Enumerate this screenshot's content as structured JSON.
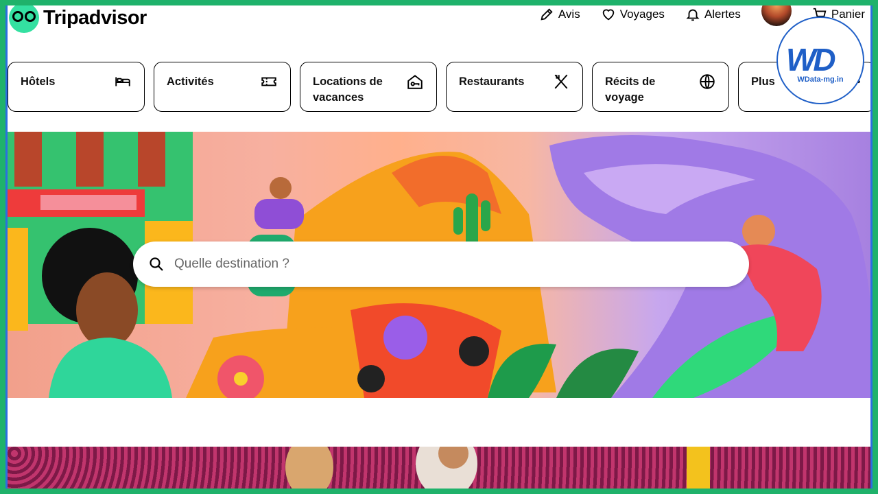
{
  "brand": {
    "name": "Tripadvisor"
  },
  "topnav": [
    {
      "id": "reviews",
      "label": "Avis",
      "icon": "pencil-icon"
    },
    {
      "id": "trips",
      "label": "Voyages",
      "icon": "heart-icon"
    },
    {
      "id": "alerts",
      "label": "Alertes",
      "icon": "bell-icon"
    },
    {
      "id": "cart",
      "label": "Panier",
      "icon": "cart-icon"
    }
  ],
  "categories": [
    {
      "label": "Hôtels",
      "icon": "bed-icon"
    },
    {
      "label": "Activités",
      "icon": "ticket-icon"
    },
    {
      "label": "Locations de vacances",
      "icon": "house-key-icon"
    },
    {
      "label": "Restaurants",
      "icon": "utensils-icon"
    },
    {
      "label": "Récits de voyage",
      "icon": "globe-icon"
    },
    {
      "label": "Plus",
      "icon": "more-icon"
    }
  ],
  "search": {
    "placeholder": "Quelle destination ?"
  },
  "watermark": {
    "letters": "WD",
    "site": "WData-mg.in"
  },
  "colors": {
    "brand_green": "#34e0a1",
    "frame_green": "#1fb26b",
    "watermark_blue": "#1f5fc7"
  }
}
